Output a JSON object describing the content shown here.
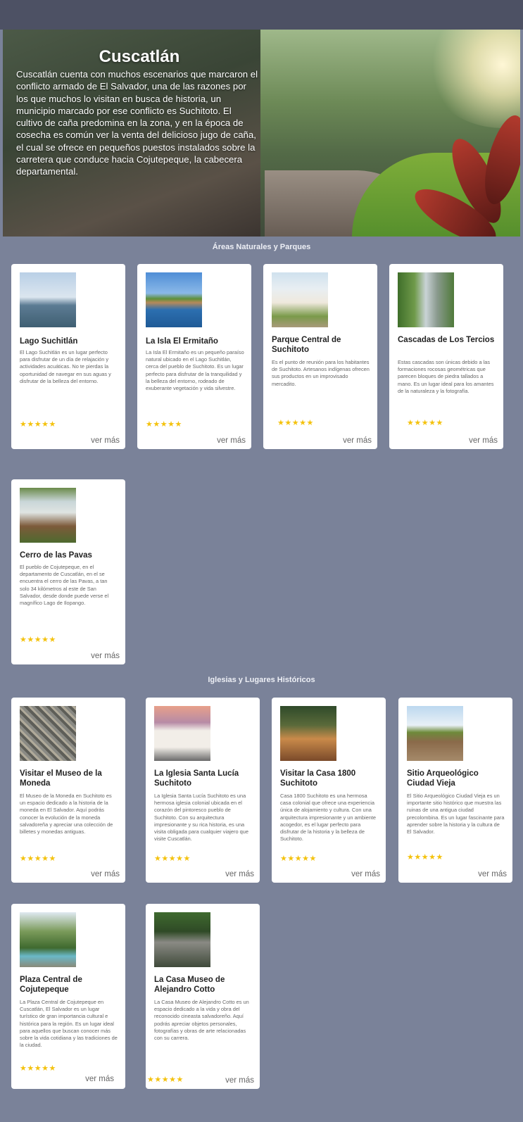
{
  "hero": {
    "title": "Cuscatlán",
    "text": "Cuscatlán cuenta con muchos escenarios que marcaron el conflicto armado de El Salvador, una de las razones por los que muchos lo visitan en busca de historia, un municipio marcado por ese conflicto es Suchitoto. El cultivo de caña predomina en la zona, y en la época de cosecha es común ver la venta del delicioso jugo de caña, el cual se ofrece en pequeños puestos instalados sobre la carretera que conduce hacia Cojutepeque, la cabecera departamental."
  },
  "sections": {
    "natural": {
      "title": "Áreas Naturales y Parques",
      "cards": [
        {
          "title": "Lago Suchitlán",
          "text": "El Lago Suchitlán es un lugar perfecto para disfrutar de un día de relajación y actividades acuáticas. No te pierdas la oportunidad de navegar en sus aguas y disfrutar de la belleza del entorno.",
          "stars": "★★★★★",
          "more": "ver más"
        },
        {
          "title": "La Isla El Ermitaño",
          "text": "La Isla El Ermitaño es un pequeño paraíso natural ubicado en el Lago Suchitlán, cerca del pueblo de Suchitoto. Es un lugar perfecto para disfrutar de la tranquilidad y la belleza del entorno, rodeado de exuberante vegetación y vida silvestre.",
          "stars": "★★★★★",
          "more": "ver más"
        },
        {
          "title": "Parque Central de Suchitoto",
          "text": "Es el punto de reunión para los habitantes de Suchitoto. Artesanos indígenas ofrecen sus productos en un improvisado mercadito.",
          "stars": "★★★★★",
          "more": "ver más"
        },
        {
          "title": "Cascadas de Los Tercios",
          "text": "Estas cascadas son únicas debido a las formaciones rocosas geométricas que parecen bloques de piedra tallados a mano. Es un lugar ideal para los amantes de la naturaleza y la fotografía.",
          "stars": "★★★★★",
          "more": "ver más"
        },
        {
          "title": "Cerro de las Pavas",
          "text": "El pueblo de Cojutepeque, en el departamento de Cuscatlán, en el se encuentra el cerro de las Pavas, a tan solo 34 kilómetros al este de San Salvador, desde donde puede verse el magnífico Lago de Ilopango.",
          "stars": "★★★★★",
          "more": "ver más"
        }
      ]
    },
    "historic": {
      "title": "Iglesias y Lugares Históricos",
      "cards": [
        {
          "title": "Visitar el Museo de la Moneda",
          "text": "El Museo de la Moneda en Suchitoto es un espacio dedicado a la historia de la moneda en El Salvador. Aquí podrás conocer la evolución de la moneda salvadoreña y apreciar una colección de billetes y monedas antiguas.",
          "stars": "★★★★★",
          "more": "ver más"
        },
        {
          "title": "La Iglesia Santa Lucía Suchitoto",
          "text": "La Iglesia Santa Lucía Suchitoto es una hermosa iglesia colonial ubicada en el corazón del pintoresco pueblo de Suchitoto. Con su arquitectura impresionante y su rica historia, es una visita obligada para cualquier viajero que visite Cuscatlán.",
          "stars": "★★★★★",
          "more": "ver más"
        },
        {
          "title": "Visitar la Casa 1800 Suchitoto",
          "text": "Casa 1800 Suchitoto es una hermosa casa colonial que ofrece una experiencia única de alojamiento y cultura. Con una arquitectura impresionante y un ambiente acogedor, es el lugar perfecto para disfrutar de la historia y la belleza de Suchitoto.",
          "stars": "★★★★★",
          "more": "ver más"
        },
        {
          "title": "Sitio Arqueológico Ciudad Vieja",
          "text": "El Sitio Arqueológico Ciudad Vieja es un importante sitio histórico que muestra las ruinas de una antigua ciudad precolombina. Es un lugar fascinante para aprender sobre la historia y la cultura de El Salvador.",
          "stars": "★★★★★",
          "more": "ver más"
        },
        {
          "title": "Plaza Central de Cojutepeque",
          "text": "La Plaza Central de Cojutepeque en Cuscatlán, El Salvador es un lugar turístico de gran importancia cultural e histórica para la región. Es un lugar ideal para aquellos que buscan conocer más sobre la vida cotidiana y las tradiciones de la ciudad.",
          "stars": "★★★★★",
          "more": "ver más"
        },
        {
          "title": "La Casa Museo de Alejandro Cotto",
          "text": "La Casa Museo de Alejandro Cotto es un espacio dedicado a la vida y obra del reconocido cineasta salvadoreño. Aquí podrás apreciar objetos personales, fotografías y obras de arte relacionadas con su carrera.",
          "stars": "★★★★★",
          "more": "ver más"
        }
      ]
    }
  }
}
